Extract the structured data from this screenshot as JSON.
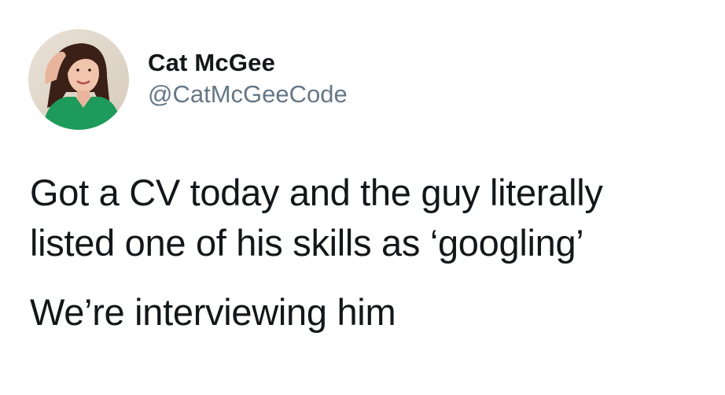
{
  "author": {
    "display_name": "Cat McGee",
    "handle": "@CatMcGeeCode",
    "avatar_icon": "profile-photo-avatar"
  },
  "tweet": {
    "lines": [
      "Got a CV today and the guy literally",
      "listed one of his skills as ‘googling’"
    ],
    "followup": "We’re interviewing him"
  },
  "colors": {
    "text": "#14171a",
    "secondary_text": "#657786",
    "avatar_shirt": "#1e9b5a"
  }
}
